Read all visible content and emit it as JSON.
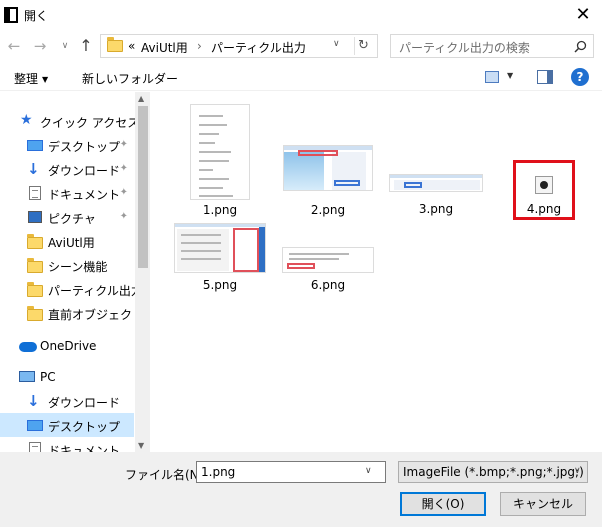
{
  "window": {
    "title": "開く",
    "close_glyph": "✕"
  },
  "nav": {
    "back": "←",
    "forward": "→",
    "recent": "∨",
    "up": "↑"
  },
  "address": {
    "prefix": "«",
    "crumbs": [
      "AviUtl用",
      "パーティクル出力"
    ],
    "separator": "›",
    "dropdown": "∨",
    "refresh": "↻"
  },
  "search": {
    "placeholder": "パーティクル出力の検索"
  },
  "toolbar": {
    "organize": "整理",
    "organize_arrow": "▼",
    "new_folder": "新しいフォルダー",
    "view_dropdown": "▼",
    "help": "?"
  },
  "sidebar": {
    "items": [
      {
        "label": "クイック アクセス",
        "icon": "star-icon",
        "pinned": false
      },
      {
        "label": "デスクトップ",
        "icon": "desktop-icon",
        "pinned": true
      },
      {
        "label": "ダウンロード",
        "icon": "download-icon",
        "pinned": true
      },
      {
        "label": "ドキュメント",
        "icon": "document-icon",
        "pinned": true
      },
      {
        "label": "ピクチャ",
        "icon": "pictures-icon",
        "pinned": true
      },
      {
        "label": "AviUtl用",
        "icon": "folder-icon",
        "pinned": false
      },
      {
        "label": "シーン機能",
        "icon": "folder-icon",
        "pinned": false
      },
      {
        "label": "パーティクル出力",
        "icon": "folder-icon",
        "pinned": false
      },
      {
        "label": "直前オブジェクト",
        "icon": "folder-icon",
        "pinned": false
      },
      {
        "label": "OneDrive",
        "icon": "onedrive-icon",
        "pinned": false
      },
      {
        "label": "PC",
        "icon": "pc-icon",
        "pinned": false
      },
      {
        "label": "ダウンロード",
        "icon": "download-icon",
        "pinned": false
      },
      {
        "label": "デスクトップ",
        "icon": "desktop-icon",
        "pinned": false,
        "selected": true
      },
      {
        "label": "ドキュメント",
        "icon": "document-icon",
        "pinned": false
      }
    ],
    "scroll_up": "▲",
    "scroll_down": "▼",
    "pin_glyph": "📌"
  },
  "files": [
    {
      "name": "1.png"
    },
    {
      "name": "2.png"
    },
    {
      "name": "3.png"
    },
    {
      "name": "4.png",
      "highlighted": true,
      "highlight_color": "#e0101a"
    },
    {
      "name": "5.png"
    },
    {
      "name": "6.png"
    }
  ],
  "bottom": {
    "filename_label": "ファイル名(N):",
    "filename_value": "1.png",
    "filetype_value": "ImageFile (*.bmp;*.png;*.jpg;)",
    "caret": "∨",
    "open_button": "開く(O)",
    "cancel_button": "キャンセル"
  },
  "colors": {
    "selection": "#cce8ff",
    "accent": "#0078d7",
    "highlight_box": "#e0101a"
  }
}
